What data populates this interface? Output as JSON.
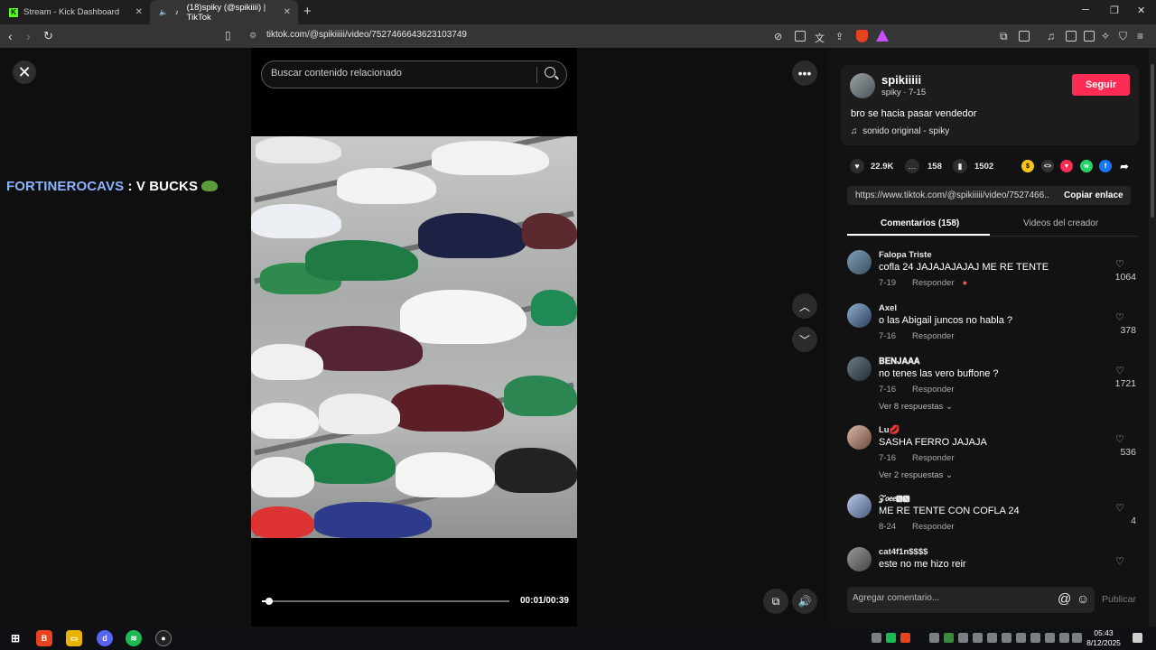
{
  "browser": {
    "tabs": [
      {
        "title": "Stream - Kick Dashboard",
        "active": false
      },
      {
        "title": "(18)spiky (@spikiiii) | TikTok",
        "active": true
      }
    ],
    "url": "tiktok.com/@spikiiiii/video/7527466643623103749"
  },
  "overlay": {
    "user": "FORTINEROCAVS",
    "sep": " : ",
    "message": "V BUCKS"
  },
  "search": {
    "placeholder": "Buscar contenido relacionado"
  },
  "player": {
    "time": "00:01/00:39",
    "progress": 0.03
  },
  "author": {
    "username": "spikiiiii",
    "subline": "spiky · 7-15",
    "follow_label": "Seguir",
    "caption": "bro se hacia pasar vendedor",
    "sound": "sonido original - spiky"
  },
  "stats": {
    "likes": "22.9K",
    "comments": "158",
    "saves": "1502"
  },
  "link": {
    "url": "https://www.tiktok.com/@spikiiiii/video/7527466...",
    "copy_label": "Copiar enlace"
  },
  "panel_tabs": {
    "comments": "Comentarios (158)",
    "creator": "Videos del creador"
  },
  "comments": [
    {
      "name": "Falopa Triste",
      "text": "cofla 24 JAJAJAJAJAJ ME RE TENTE",
      "date": "7-19",
      "reply": "Responder",
      "likes": "1064",
      "more": ""
    },
    {
      "name": "Axel",
      "text": "o las Abigail juncos no habla ?",
      "date": "7-16",
      "reply": "Responder",
      "likes": "378",
      "more": ""
    },
    {
      "name": "𝐁𝐄𝐍𝐉𝐀𝐀𝐀",
      "text": "no tenes las vero buffone ?",
      "date": "7-16",
      "reply": "Responder",
      "likes": "1721",
      "more": "Ver 8 respuestas"
    },
    {
      "name": "Lu💋",
      "text": "SASHA FERRO JAJAJA",
      "date": "7-16",
      "reply": "Responder",
      "likes": "536",
      "more": "Ver 2 respuestas"
    },
    {
      "name": "𝒵𝑜𝑒𝑒🆇🆇",
      "text": "ME RE TENTE CON COFLA 24",
      "date": "8-24",
      "reply": "Responder",
      "likes": "4",
      "more": ""
    },
    {
      "name": "cat4f1n$$$$",
      "text": "este no me hizo reir",
      "date": "",
      "reply": "",
      "likes": "",
      "more": ""
    }
  ],
  "comment_input": {
    "placeholder": "Agregar comentario...",
    "publish_label": "Publicar"
  },
  "taskbar": {
    "time": "05:43",
    "date": "8/12/2025"
  },
  "colors": {
    "accent": "#fe2c55",
    "link_blue": "#8ab4ff"
  }
}
